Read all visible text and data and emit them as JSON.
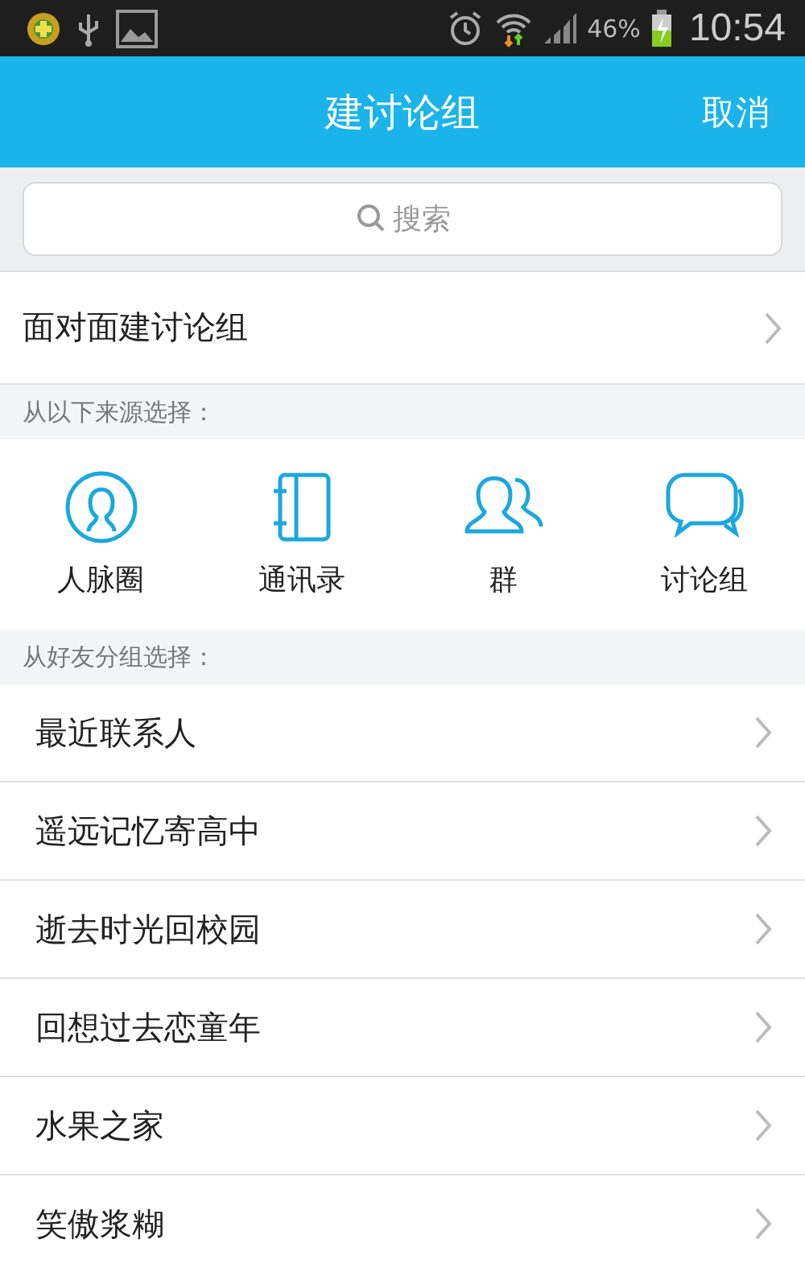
{
  "status_bar": {
    "battery": "46%",
    "time": "10:54"
  },
  "header": {
    "title": "建讨论组",
    "action": "取消"
  },
  "search": {
    "placeholder": "搜索"
  },
  "face_to_face": {
    "label": "面对面建讨论组"
  },
  "sources_heading": "从以下来源选择：",
  "sources": [
    {
      "kind": "contacts-circle",
      "label": "人脉圈"
    },
    {
      "kind": "address-book",
      "label": "通讯录"
    },
    {
      "kind": "group",
      "label": "群"
    },
    {
      "kind": "discussion",
      "label": "讨论组"
    }
  ],
  "groups_heading": "从好友分组选择：",
  "groups": [
    {
      "label": "最近联系人"
    },
    {
      "label": "遥远记忆寄高中"
    },
    {
      "label": "逝去时光回校园"
    },
    {
      "label": "回想过去恋童年"
    },
    {
      "label": "水果之家"
    },
    {
      "label": "笑傲浆糊"
    }
  ]
}
